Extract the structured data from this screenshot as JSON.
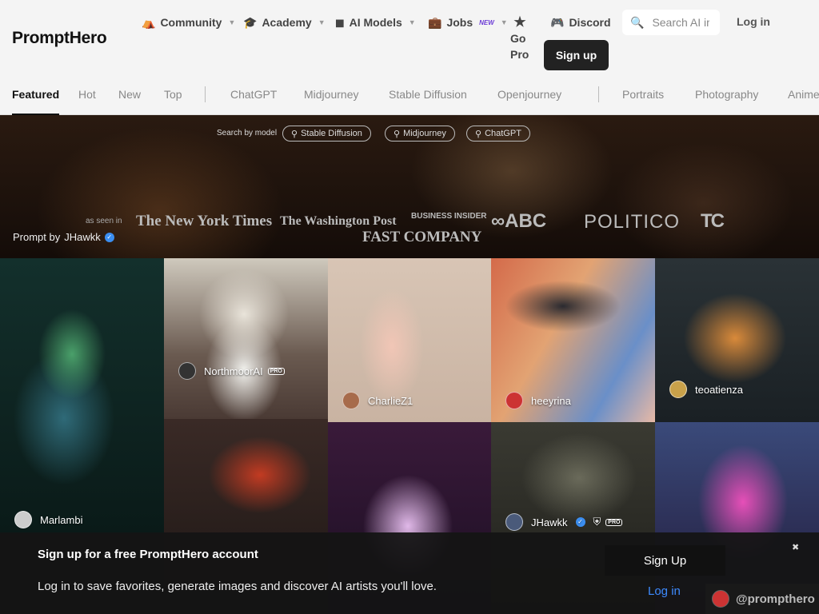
{
  "header": {
    "logo": "PromptHero",
    "nav": {
      "community": "Community",
      "academy": "Academy",
      "ai_models": "AI Models",
      "jobs": "Jobs",
      "jobs_badge": "NEW",
      "go_pro_line1": "Go",
      "go_pro_line2": "Pro",
      "discord": "Discord"
    },
    "search_placeholder": "Search AI images",
    "login": "Log in",
    "signup": "Sign up"
  },
  "tabs": {
    "featured": "Featured",
    "hot": "Hot",
    "new": "New",
    "top": "Top",
    "chatgpt": "ChatGPT",
    "midjourney": "Midjourney",
    "stable_diffusion": "Stable Diffusion",
    "openjourney": "Openjourney",
    "portraits": "Portraits",
    "photography": "Photography",
    "anime": "Anime"
  },
  "hero": {
    "search_by": "Search by model",
    "models": [
      "Stable Diffusion",
      "Midjourney",
      "ChatGPT"
    ],
    "as_seen_in": "as seen in",
    "press": {
      "nyt": "The New York Times",
      "wapo": "The Washington Post",
      "business_insider": "BUSINESS INSIDER",
      "fast_company": "FAST COMPANY",
      "abc": "ABC",
      "politico": "POLITICO",
      "techcrunch": "TC"
    },
    "prompt_by_label": "Prompt by",
    "prompt_by_user": "JHawkk"
  },
  "grid": {
    "authors": {
      "marlambi": "Marlambi",
      "northmoorai": "NorthmoorAI",
      "charliez1": "CharlieZ1",
      "heeyrina": "heeyrina",
      "teoatienza": "teoatienza",
      "jhawkk": "JHawkk"
    },
    "pro_badge": "PRO"
  },
  "banner": {
    "title": "Sign up for a free PromptHero account",
    "text": "Log in to save favorites, generate images and discover AI artists you'll love.",
    "signup": "Sign Up",
    "login": "Log in",
    "close": "✖",
    "handle": "@prompthero"
  }
}
